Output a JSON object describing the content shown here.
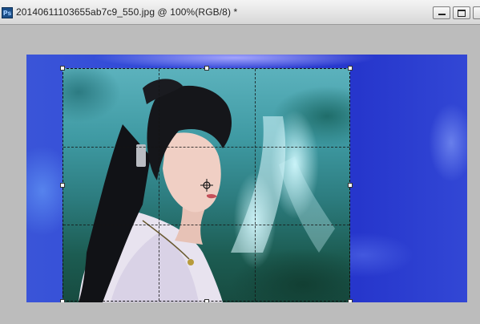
{
  "window": {
    "app_icon_label": "Ps",
    "title": "20140611103655ab7c9_550.jpg @ 100%(RGB/8) *"
  },
  "colors": {
    "workspace": "#bcbcbc",
    "canvas_blue": "#2e44d6",
    "photo_teal": "#3f9aa3"
  },
  "icons": {
    "app": "photoshop-icon",
    "minimize": "minimize-icon",
    "restore": "restore-icon",
    "close": "close-icon",
    "pivot": "crosshair-icon"
  }
}
